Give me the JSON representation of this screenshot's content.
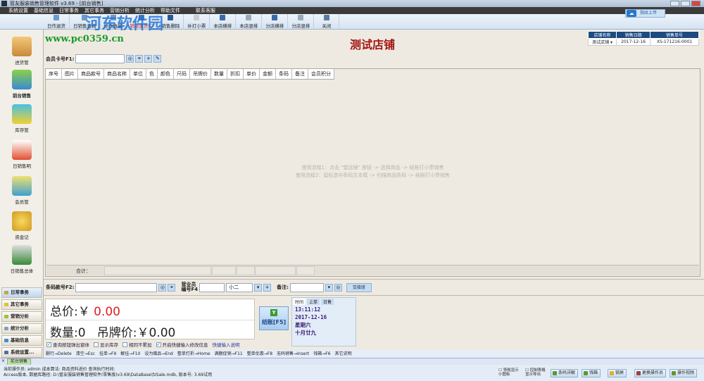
{
  "window": {
    "title": "管友服装销售管理软件 v3.69 - [前台销售]"
  },
  "menu": [
    "系统设置",
    "基础信息",
    "日常事务",
    "其它事务",
    "营销分析",
    "统计分析",
    "帮助文件",
    "联系客服"
  ],
  "toolbar": [
    "日作退货",
    "日销售查询",
    "修改数量",
    "销售退货F7",
    "销售删除",
    "补打小票",
    "本店横排",
    "本店竖排",
    "分店横排",
    "分店竖排",
    "关闭"
  ],
  "upload_button": "指纹上传",
  "watermark": {
    "text": "河东软件园",
    "url": "www.pc0359.cn"
  },
  "sidebar": {
    "items": [
      "进货管",
      "前台销售",
      "库存管",
      "日销售明",
      "会员管",
      "资金记",
      "日销售总体"
    ],
    "nav": [
      "日常事务",
      "其它事务",
      "营销分析",
      "统计分析",
      "基础信息",
      "系统设置..."
    ]
  },
  "store_title": "测试店铺",
  "info": {
    "headers": [
      "店铺名称",
      "销售日期",
      "销售单号"
    ],
    "store": "测试店铺",
    "date": "2017-12-16",
    "order_no": "XS-171216-0001"
  },
  "member": {
    "label": "会员卡号F1:",
    "value": ""
  },
  "grid": {
    "columns": [
      "序号",
      "图片",
      "商品款号",
      "商品名称",
      "单位",
      "色",
      "颜色",
      "尺码",
      "吊牌价",
      "数量",
      "折扣",
      "单价",
      "金额",
      "条码",
      "备注",
      "会员积分"
    ],
    "hints": [
      "使用流程1：点击 \"望远镜\" 按钮 -> 选择商品 -> 结账打小票销售",
      "使用流程2：鼠标选中条码文本框 -> 扫描商品条码 -> 结账打小票销售"
    ],
    "total_label": "合计："
  },
  "barcode": {
    "label": "条码款号F2:",
    "value": "",
    "salesman_label1": "营业员",
    "salesman_label2": "编号F4",
    "salesman_code": "",
    "salesman_name": "小二",
    "remark_label": "备注:",
    "remark": "",
    "shift_button": "交接班"
  },
  "totals": {
    "total_label": "总价:",
    "currency": "￥",
    "total": "0.00",
    "qty_label": "数量:",
    "qty": "0",
    "tag_label": "吊牌价:",
    "tag": "￥0.00"
  },
  "checkout": {
    "icon_text": "Y",
    "label": "结账[F5]"
  },
  "timepanel": {
    "tabs": [
      "时间",
      "上单",
      "日售"
    ],
    "time": "13:11:12",
    "date": "2017-12-16",
    "weekday": "星期六",
    "lunar": "十月廿九"
  },
  "checks": [
    {
      "label": "查询按钮弹出窗体",
      "checked": true
    },
    {
      "label": "显示库存",
      "checked": false
    },
    {
      "label": "相同不累加",
      "checked": false
    },
    {
      "label": "开启快捷输入修改信息",
      "checked": true
    }
  ],
  "quick_help": "快捷输入说明",
  "shortcuts": [
    "删行→Delete",
    "清空→Esc",
    "挂单→F9",
    "解挂→F10",
    "设为赠品→End",
    "整单打折→Home",
    "满额促销→F11",
    "整单优惠→F8",
    "无码销售→Insert",
    "钱箱→F6",
    "其它说明"
  ],
  "tab": "前台销售",
  "status": {
    "line1": "当前操作员: admin  成本算法: 商品资料进价  查询执行时间:",
    "line2": "Access版本, 数据库路径: D:\\管友服装销售管理软件(零售版)v3.69\\DataBase\\fzSale.mdb, 版本号: 3.69试用"
  },
  "bottom": {
    "opt1": "导航显示小图标",
    "opt2": "控制表格显示导出",
    "buttons": [
      "条码详解",
      "钱箱",
      "锁屏",
      "更换操作员",
      "操作视频"
    ]
  }
}
